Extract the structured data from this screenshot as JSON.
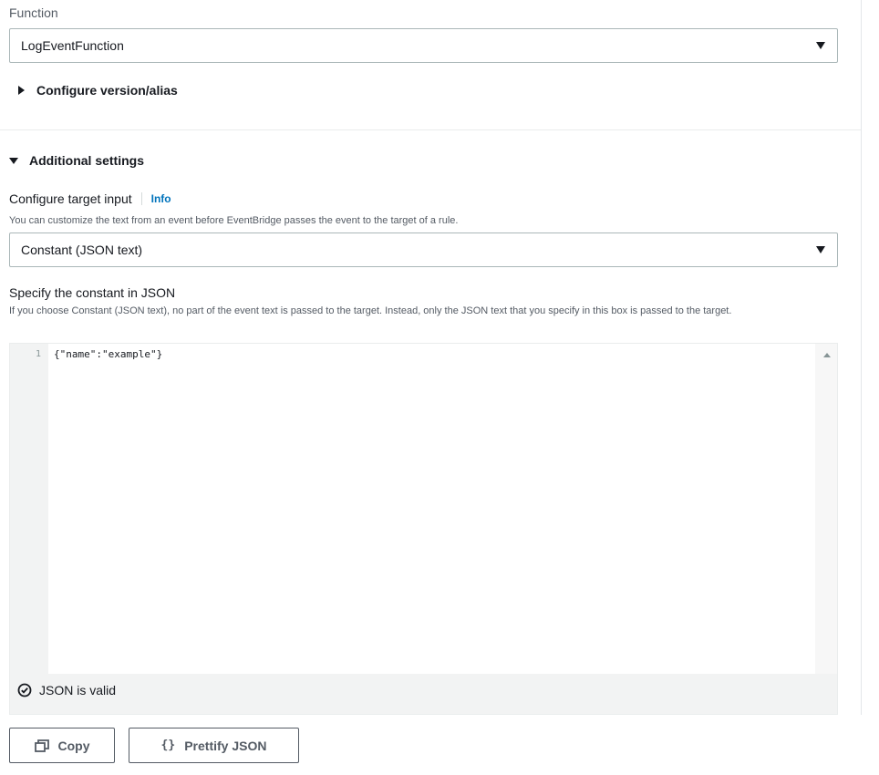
{
  "function_field": {
    "label": "Function",
    "value": "LogEventFunction"
  },
  "version_alias": {
    "label": "Configure version/alias"
  },
  "additional_settings": {
    "label": "Additional settings"
  },
  "target_input": {
    "label": "Configure target input",
    "info": "Info",
    "description": "You can customize the text from an event before EventBridge passes the event to the target of a rule.",
    "value": "Constant (JSON text)"
  },
  "constant_json": {
    "label": "Specify the constant in JSON",
    "description": "If you choose Constant (JSON text), no part of the event text is passed to the target. Instead, only the JSON text that you specify in this box is passed to the target.",
    "line_number": "1",
    "code": "{\"name\":\"example\"}",
    "status": "JSON is valid"
  },
  "buttons": {
    "copy": "Copy",
    "prettify": "Prettify JSON"
  },
  "colors": {
    "text": "#16191f",
    "link": "#0073bb",
    "muted": "#545b64"
  }
}
